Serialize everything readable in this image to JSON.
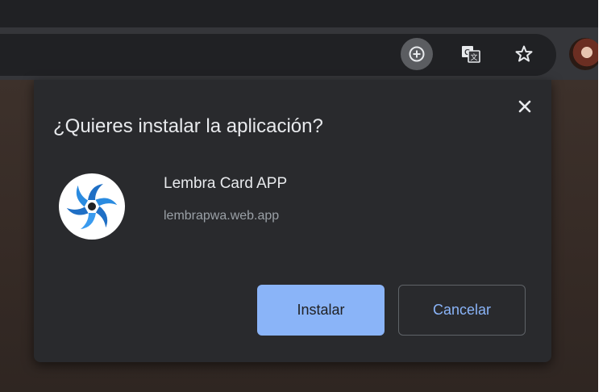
{
  "toolbar": {
    "install_icon": "install-app-icon",
    "translate_icon": "translate-icon",
    "bookmark_icon": "star-icon",
    "profile_icon": "avatar"
  },
  "dialog": {
    "title": "¿Quieres instalar la aplicación?",
    "close_icon": "close-icon",
    "app": {
      "name": "Lembra Card APP",
      "url": "lembrapwa.web.app",
      "icon": "app-logo-icon"
    },
    "install_label": "Instalar",
    "cancel_label": "Cancelar"
  },
  "colors": {
    "accent": "#8ab4f8",
    "dialog_bg": "#292a2d",
    "toolbar_bg": "#35363a",
    "text_primary": "#e8eaed",
    "text_secondary": "#9aa0a6"
  }
}
